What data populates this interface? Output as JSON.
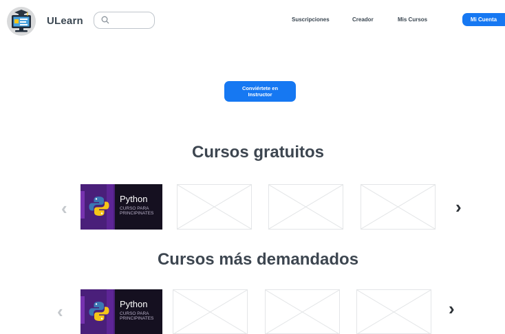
{
  "header": {
    "brand": "ULearn",
    "search_placeholder": "",
    "nav": [
      {
        "label": "Suscripciones"
      },
      {
        "label": "Creador"
      },
      {
        "label": "Mis Cursos"
      }
    ],
    "account_button": "Mi Cuenta"
  },
  "cta": {
    "label": "Conviértete en Instructor"
  },
  "sections": [
    {
      "title": "Cursos gratuitos",
      "courses": [
        {
          "title": "Python",
          "subtitle": "CURSO PARA PRINCIPINATES"
        },
        {
          "placeholder": true
        },
        {
          "placeholder": true
        },
        {
          "placeholder": true
        }
      ]
    },
    {
      "title": "Cursos más demandados",
      "courses": [
        {
          "title": "Python",
          "subtitle": "CURSO PARA PRINCIPINATES"
        },
        {
          "placeholder": true
        },
        {
          "placeholder": true
        },
        {
          "placeholder": true
        }
      ]
    }
  ],
  "icons": {
    "logo": "computer-graduation-cap-icon",
    "search": "search-icon",
    "prev": "chevron-left-icon",
    "next": "chevron-right-icon",
    "python": "python-logo-icon"
  },
  "colors": {
    "accent": "#1678f2",
    "text": "#3d4650",
    "placeholder_border": "#e3e5e7"
  }
}
